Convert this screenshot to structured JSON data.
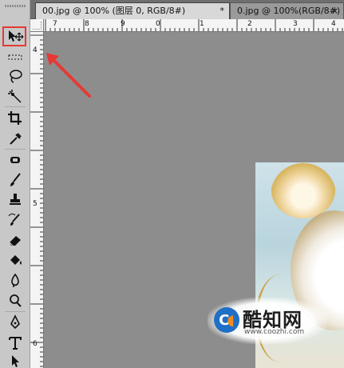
{
  "tabs": [
    {
      "label": "00.jpg @ 100% (图层 0, RGB/8#)",
      "close": "*"
    },
    {
      "label": "0.jpg @ 100%(RGB/8#)",
      "close": "×"
    }
  ],
  "ruler_top": [
    "7",
    "8",
    "9",
    "0",
    "1",
    "2",
    "3",
    "4"
  ],
  "ruler_left": [
    "4",
    "5",
    "6"
  ],
  "tools": [
    {
      "name": "move-tool-icon"
    },
    {
      "name": "marquee-tool-icon"
    },
    {
      "name": "lasso-tool-icon"
    },
    {
      "name": "quick-selection-tool-icon"
    },
    {
      "name": "crop-tool-icon"
    },
    {
      "name": "eyedropper-tool-icon"
    },
    {
      "name": "spot-healing-tool-icon"
    },
    {
      "name": "brush-tool-icon"
    },
    {
      "name": "clone-stamp-tool-icon"
    },
    {
      "name": "history-brush-tool-icon"
    },
    {
      "name": "eraser-tool-icon"
    },
    {
      "name": "paint-bucket-tool-icon"
    },
    {
      "name": "blur-tool-icon"
    },
    {
      "name": "dodge-tool-icon"
    },
    {
      "name": "pen-tool-icon"
    },
    {
      "name": "type-tool-icon"
    },
    {
      "name": "path-selection-tool-icon"
    }
  ],
  "watermark": {
    "title": "酷知网",
    "url": "www.coozhi.com",
    "logo_letter": "C"
  },
  "colors": {
    "highlight": "#e53935",
    "canvas_bg": "#8d8d8d",
    "toolbar_bg": "#c8c8c8"
  }
}
